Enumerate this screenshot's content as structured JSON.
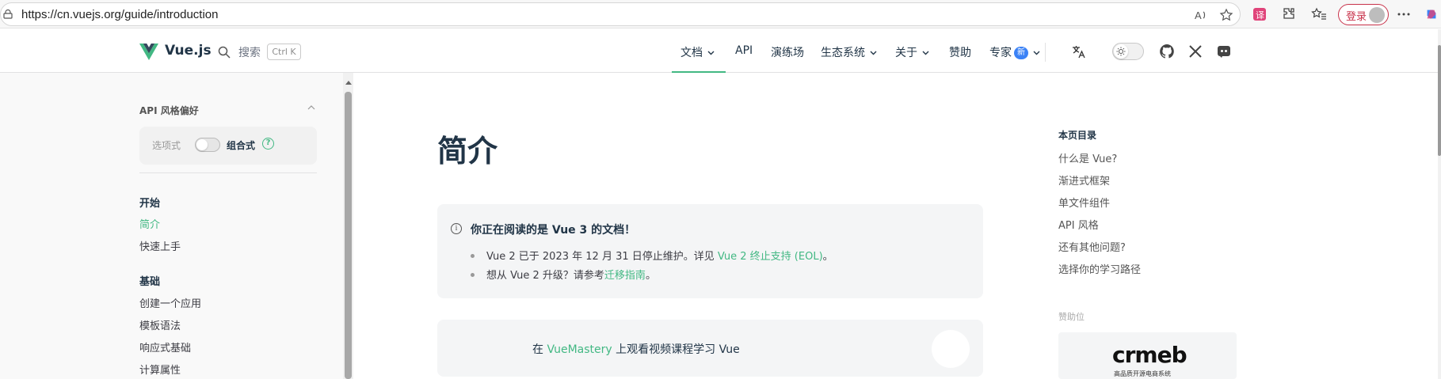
{
  "browser": {
    "url": "https://cn.vuejs.org/guide/introduction",
    "login_label": "登录"
  },
  "nav": {
    "brand": "Vue.js",
    "search_label": "搜索",
    "search_kbd": "Ctrl K",
    "items": [
      {
        "label": "文档",
        "dropdown": true
      },
      {
        "label": "API",
        "dropdown": false
      },
      {
        "label": "演练场",
        "dropdown": false
      },
      {
        "label": "生态系统",
        "dropdown": true
      },
      {
        "label": "关于",
        "dropdown": true
      },
      {
        "label": "赞助",
        "dropdown": false
      },
      {
        "label": "专家",
        "dropdown": true,
        "badge": "新"
      }
    ],
    "active_item": "文档"
  },
  "sidebar": {
    "pref_title": "API 风格偏好",
    "pref_option": "选项式",
    "pref_selected": "组合式",
    "pref_help": "?",
    "sections": [
      {
        "title": "开始",
        "links": [
          "简介",
          "快速上手"
        ]
      },
      {
        "title": "基础",
        "links": [
          "创建一个应用",
          "模板语法",
          "响应式基础",
          "计算属性"
        ]
      }
    ],
    "active_link": "简介"
  },
  "main": {
    "title": "简介",
    "tip": {
      "icon": "i",
      "title": "你正在阅读的是 Vue 3 的文档！",
      "item1_prefix": "Vue 2 已于 2023 年 12 月 31 日停止维护。详见 ",
      "item1_link": "Vue 2 终止支持 (EOL)",
      "item1_suffix": "。",
      "item2_prefix": "想从 Vue 2 升级？请参考",
      "item2_link": "迁移指南",
      "item2_suffix": "。"
    },
    "vuemastery": {
      "prefix": "在 ",
      "link": "VueMastery",
      "suffix": " 上观看视频课程学习 Vue"
    }
  },
  "toc": {
    "title": "本页目录",
    "links": [
      "什么是 Vue?",
      "渐进式框架",
      "单文件组件",
      "API 风格",
      "还有其他问题?",
      "选择你的学习路径"
    ],
    "sponsor_label": "赞助位",
    "sponsor_logo": "crmeb",
    "sponsor_sub": "高品质开源电商系统"
  },
  "colors": {
    "accent": "#42b883",
    "text": "#213547",
    "badge": "#3b82f6",
    "login": "#c8324a"
  }
}
